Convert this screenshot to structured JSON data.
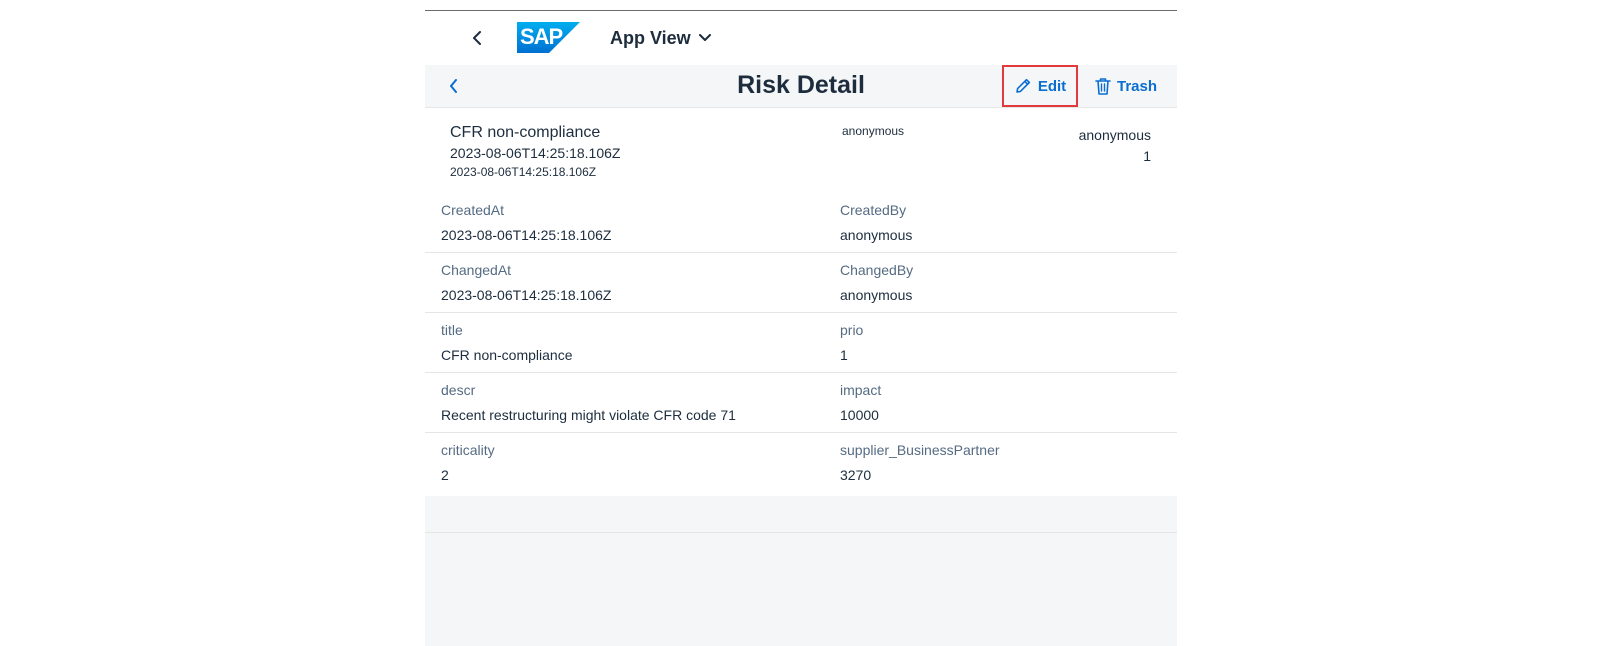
{
  "shell": {
    "logo_text": "SAP",
    "app_title": "App View"
  },
  "header": {
    "title": "Risk Detail",
    "edit_label": "Edit",
    "trash_label": "Trash"
  },
  "object_header": {
    "title": "CFR non-compliance",
    "subtitle1": "2023-08-06T14:25:18.106Z",
    "subtitle2": "2023-08-06T14:25:18.106Z",
    "middle": "anonymous",
    "right_top": "anonymous",
    "right_bottom": "1"
  },
  "fields": [
    {
      "left_label": "CreatedAt",
      "left_value": "2023-08-06T14:25:18.106Z",
      "right_label": "CreatedBy",
      "right_value": "anonymous"
    },
    {
      "left_label": "ChangedAt",
      "left_value": "2023-08-06T14:25:18.106Z",
      "right_label": "ChangedBy",
      "right_value": "anonymous"
    },
    {
      "left_label": "title",
      "left_value": "CFR non-compliance",
      "right_label": "prio",
      "right_value": "1"
    },
    {
      "left_label": "descr",
      "left_value": "Recent restructuring might violate CFR code 71",
      "right_label": "impact",
      "right_value": "10000"
    },
    {
      "left_label": "criticality",
      "left_value": "2",
      "right_label": "supplier_BusinessPartner",
      "right_value": "3270"
    }
  ],
  "colors": {
    "accent": "#0a6ed1",
    "highlight_border": "#e0393e",
    "sap_blue": "#0070d2"
  },
  "icons": {
    "shell_back": "chevron-left-icon",
    "app_menu": "chevron-down-icon",
    "page_back": "chevron-left-icon",
    "edit": "pencil-icon",
    "trash": "trash-icon"
  }
}
